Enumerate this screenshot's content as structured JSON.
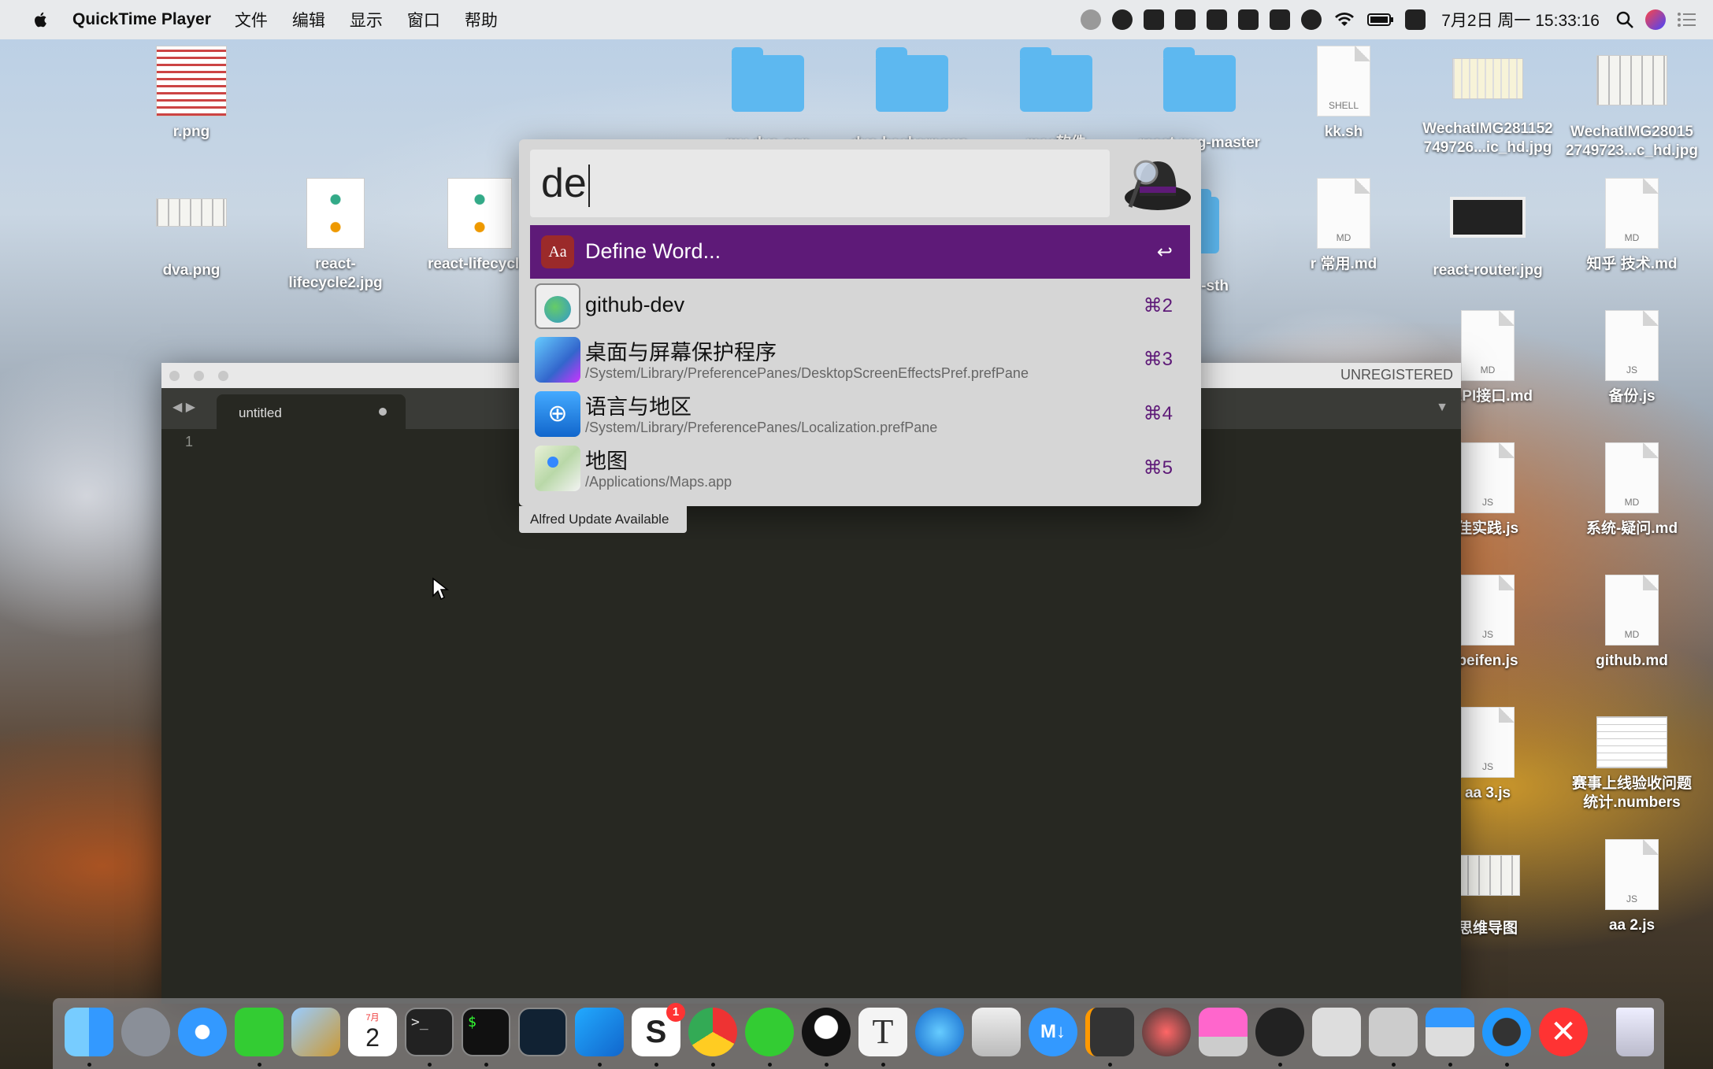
{
  "menubar": {
    "app_name": "QuickTime Player",
    "menus": [
      "文件",
      "编辑",
      "显示",
      "窗口",
      "帮助"
    ],
    "clock": "7月2日 周一  15:33:16"
  },
  "desktop_icons": {
    "r_png": "r.png",
    "dva_png": "dva.png",
    "react_lifecycle2": "react-\nlifecycle2.jpg",
    "react_lifecycle": "react-lifecycle.",
    "folder1": "my-dva-app",
    "folder2": "dva-hackernews-",
    "folder3": "mac软件",
    "folder4": "react-nxg-master",
    "kk_sh": "kk.sh",
    "kk_tag": "SHELL",
    "wechat1": "WechatIMG281152\n749726...ic_hd.jpg",
    "wechat2": "WechatIMG28015\n2749723...c_hd.jpg",
    "sth": "-sth",
    "changyong": "r 常用.md",
    "react_router": "react-router.jpg",
    "zhihu": "知乎 技术.md",
    "api": "_API接口.md",
    "beifen_js": "备份.js",
    "shijian": "佳实践.js",
    "xitong": "系统-疑问.md",
    "peifen": "peifen.js",
    "github_md": "github.md",
    "aa3": "aa 3.js",
    "saishi": "赛事上线验收问题\n统计.numbers",
    "siwei": "思维导图",
    "aa2": "aa 2.js",
    "md_tag": "MD",
    "js_tag": "JS"
  },
  "editor": {
    "unregistered": "UNREGISTERED",
    "tab_label": "untitled",
    "line_number": "1"
  },
  "alfred": {
    "query": "de",
    "results": [
      {
        "title": "Define Word...",
        "shortcut": "↩",
        "path": ""
      },
      {
        "title": "github-dev",
        "shortcut": "⌘2",
        "path": ""
      },
      {
        "title": "桌面与屏幕保护程序",
        "shortcut": "⌘3",
        "path": "/System/Library/PreferencePanes/DesktopScreenEffectsPref.prefPane"
      },
      {
        "title": "语言与地区",
        "shortcut": "⌘4",
        "path": "/System/Library/PreferencePanes/Localization.prefPane"
      },
      {
        "title": "地图",
        "shortcut": "⌘5",
        "path": "/Applications/Maps.app"
      }
    ],
    "update_notice": "Alfred Update Available"
  },
  "dock": {
    "apps": [
      "finder",
      "launchpad",
      "safari",
      "evernote",
      "mail-bird",
      "calendar",
      "terminal",
      "iterm",
      "activity-monitor",
      "vscode",
      "slack",
      "chrome",
      "wechat",
      "qq",
      "typora",
      "app-store",
      "pitcher",
      "markdown",
      "sublime",
      "instruments",
      "desktop-app",
      "alfred",
      "scissors",
      "screenshot",
      "keynote",
      "quicktime",
      "cancel",
      "trash"
    ],
    "slack_badge": "1",
    "calendar_month": "7月",
    "calendar_day": "2"
  },
  "colors": {
    "alfred_accent": "#5e1a78",
    "editor_bg": "#272822"
  }
}
